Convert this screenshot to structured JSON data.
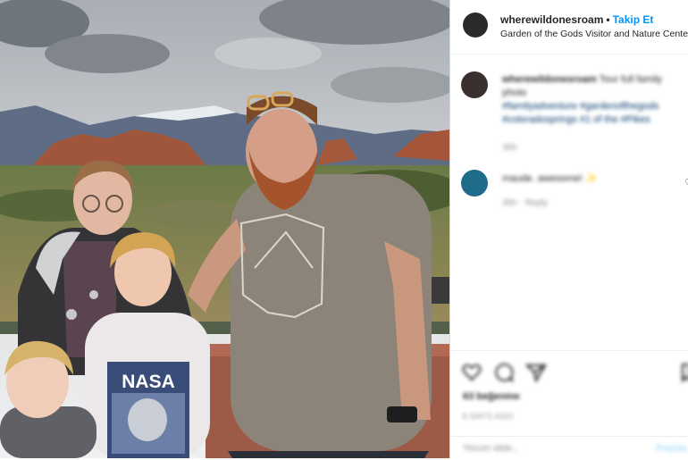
{
  "post": {
    "username": "wherewildonesroam",
    "follow_label": "Takip Et",
    "location": "Garden of the Gods Visitor and Nature Cente",
    "dot": "•"
  },
  "comments": [
    {
      "username": "wherewildonesroam",
      "text": "Tour full family photo",
      "tags": "#familyadventure #gardenofthegods #coloradosprings #1 of the #Pikes",
      "meta": "36h"
    },
    {
      "username": "",
      "text": "maude. awesome! ✨",
      "meta": "35h · Reply",
      "more": "♡"
    }
  ],
  "actions": {
    "icons": [
      "heart-icon",
      "comment-icon",
      "share-icon",
      "bookmark-icon"
    ],
    "likes": "63 beğenme",
    "date": "6 DAYS AGO",
    "add_comment_placeholder": "Yorum ekle...",
    "post_label": "Paylaş"
  },
  "photo": {
    "shirt_text": "NASA"
  }
}
